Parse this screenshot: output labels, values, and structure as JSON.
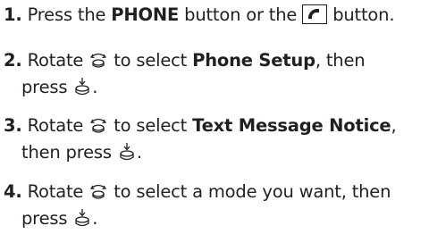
{
  "steps": [
    {
      "num": "1.",
      "t1": " Press the ",
      "k1": "PHONE",
      "t2": " button or the ",
      "icon": "phone-handset-icon",
      "t3": " button."
    },
    {
      "num": "2.",
      "t1": " Rotate ",
      "icon": "rotate-knob-icon",
      "t2": " to select ",
      "k1": "Phone Setup",
      "t3": ", then",
      "t4": "press ",
      "icon2": "press-knob-icon",
      "t5": "."
    },
    {
      "num": "3.",
      "t1": " Rotate ",
      "icon": "rotate-knob-icon",
      "t2": " to select ",
      "k1": "Text Message Notice",
      "t3": ",",
      "t4": "then press ",
      "icon2": "press-knob-icon",
      "t5": "."
    },
    {
      "num": "4.",
      "t1": " Rotate ",
      "icon": "rotate-knob-icon",
      "t2": " to select a mode you want, then",
      "t4": "press ",
      "icon2": "press-knob-icon",
      "t5": "."
    }
  ]
}
